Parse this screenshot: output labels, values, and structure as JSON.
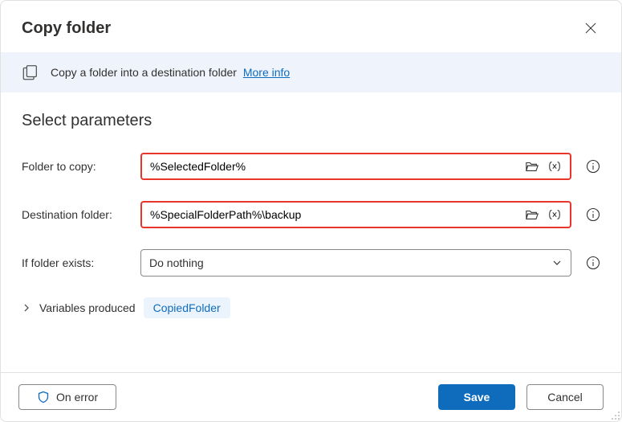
{
  "dialog": {
    "title": "Copy folder"
  },
  "banner": {
    "text": "Copy a folder into a destination folder",
    "more_info": "More info"
  },
  "section": {
    "title": "Select parameters"
  },
  "fields": {
    "folder_to_copy": {
      "label": "Folder to copy:",
      "value": "%SelectedFolder%"
    },
    "destination_folder": {
      "label": "Destination folder:",
      "value": "%SpecialFolderPath%\\backup"
    },
    "if_folder_exists": {
      "label": "If folder exists:",
      "value": "Do nothing"
    }
  },
  "variables": {
    "label": "Variables produced",
    "chip": "CopiedFolder"
  },
  "footer": {
    "on_error": "On error",
    "save": "Save",
    "cancel": "Cancel"
  }
}
